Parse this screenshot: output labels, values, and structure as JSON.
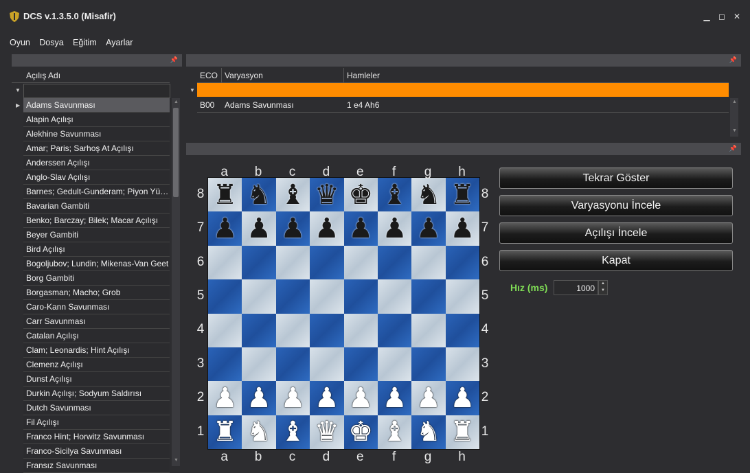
{
  "window": {
    "title": "DCS v.1.3.5.0 (Misafir)",
    "min": "▁",
    "max": "◻",
    "close": "✕"
  },
  "menu": [
    "Oyun",
    "Dosya",
    "Eğitim",
    "Ayarlar"
  ],
  "openings": {
    "header": "Açılış Adı",
    "items": [
      "Adams Savunması",
      "Alapin Açılışı",
      "Alekhine Savunması",
      "Amar; Paris; Sarhoş At Açılışı",
      "Anderssen Açılışı",
      "Anglo-Slav Açılışı",
      "Barnes; Gedult-Gunderam; Piyon Yürüyüşü",
      "Bavarian Gambiti",
      "Benko; Barczay; Bilek; Macar Açılışı",
      "Beyer Gambiti",
      "Bird Açılışı",
      "Bogoljubov; Lundin; Mikenas-Van Geet",
      "Borg Gambiti",
      "Borgasman; Macho; Grob",
      "Caro-Kann Savunması",
      "Carr Savunması",
      "Catalan Açılışı",
      "Clam; Leonardis; Hint Açılışı",
      "Clemenz Açılışı",
      "Dunst Açılışı",
      "Durkin Açılışı; Sodyum Saldırısı",
      "Dutch Savunması",
      "Fil Açılışı",
      "Franco Hint; Horwitz Savunması",
      "Franco-Sicilya Savunması",
      "Fransız Savunması"
    ]
  },
  "variations": {
    "headers": {
      "eco": "ECO",
      "name": "Varyasyon",
      "moves": "Hamleler"
    },
    "rows": [
      {
        "eco": "B00",
        "name": "Adams Savunması",
        "moves": "1 e4 Ah6"
      }
    ]
  },
  "board": {
    "files": [
      "a",
      "b",
      "c",
      "d",
      "e",
      "f",
      "g",
      "h"
    ],
    "ranks": [
      "8",
      "7",
      "6",
      "5",
      "4",
      "3",
      "2",
      "1"
    ],
    "position": [
      [
        "br",
        "bn",
        "bb",
        "bq",
        "bk",
        "bb",
        "bn",
        "br"
      ],
      [
        "bp",
        "bp",
        "bp",
        "bp",
        "bp",
        "bp",
        "bp",
        "bp"
      ],
      [
        "",
        "",
        "",
        "",
        "",
        "",
        "",
        ""
      ],
      [
        "",
        "",
        "",
        "",
        "",
        "",
        "",
        ""
      ],
      [
        "",
        "",
        "",
        "",
        "",
        "",
        "",
        ""
      ],
      [
        "",
        "",
        "",
        "",
        "",
        "",
        "",
        ""
      ],
      [
        "wp",
        "wp",
        "wp",
        "wp",
        "wp",
        "wp",
        "wp",
        "wp"
      ],
      [
        "wr",
        "wn",
        "wb",
        "wq",
        "wk",
        "wb",
        "wn",
        "wr"
      ]
    ]
  },
  "controls": {
    "replay": "Tekrar Göster",
    "examine_variation": "Varyasyonu İncele",
    "examine_opening": "Açılışı İncele",
    "close": "Kapat",
    "speed_label": "Hız (ms)",
    "speed_value": "1000"
  }
}
